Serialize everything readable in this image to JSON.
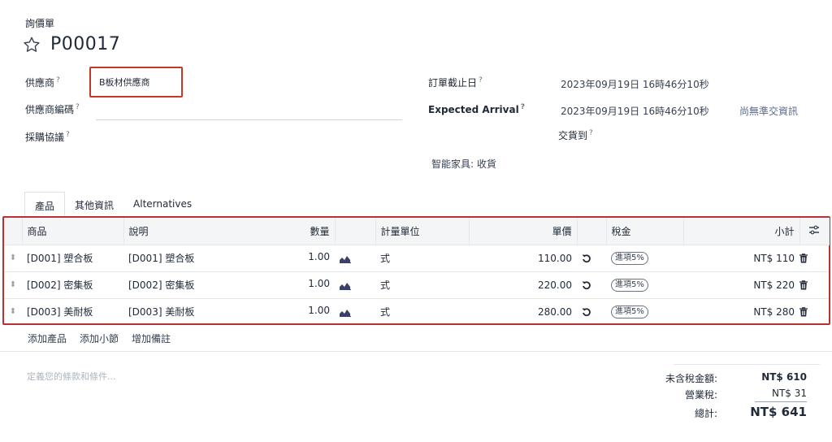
{
  "header": {
    "doc_type": "詢價單",
    "title": "P00017"
  },
  "form": {
    "vendor_label": "供應商",
    "vendor_value": "B板材供應商",
    "vendor_ref_label": "供應商編碼",
    "agreement_label": "採購協議",
    "order_deadline_label": "訂單截止日",
    "order_deadline_value": "2023年09月19日 16時46分10秒",
    "expected_arrival_label": "Expected Arrival",
    "expected_arrival_value": "2023年09月19日 16時46分10秒",
    "no_ontime_info": "尚無準交資訊",
    "deliver_to_label": "交貨到",
    "deliver_to_value": "智能家具: 收貨",
    "help_mark": "?"
  },
  "tabs": [
    {
      "label": "產品"
    },
    {
      "label": "其他資訊"
    },
    {
      "label": "Alternatives"
    }
  ],
  "table": {
    "columns": {
      "product": "商品",
      "description": "說明",
      "quantity": "數量",
      "uom": "計量單位",
      "unit_price": "單價",
      "taxes": "稅金",
      "subtotal": "小計"
    },
    "rows": [
      {
        "product": "[D001] 塑合板",
        "description": "[D001] 塑合板",
        "quantity": "1.00",
        "uom": "式",
        "unit_price": "110.00",
        "tax": "進項5%",
        "subtotal": "NT$ 110"
      },
      {
        "product": "[D002] 密集板",
        "description": "[D002] 密集板",
        "quantity": "1.00",
        "uom": "式",
        "unit_price": "220.00",
        "tax": "進項5%",
        "subtotal": "NT$ 220"
      },
      {
        "product": "[D003] 美耐板",
        "description": "[D003] 美耐板",
        "quantity": "1.00",
        "uom": "式",
        "unit_price": "280.00",
        "tax": "進項5%",
        "subtotal": "NT$ 280"
      }
    ]
  },
  "actions": {
    "add_product": "添加產品",
    "add_section": "添加小節",
    "add_note": "增加備註"
  },
  "terms_placeholder": "定義您的條款和條件...",
  "totals": {
    "untaxed_label": "未含稅金額:",
    "untaxed_value": "NT$ 610",
    "tax_label": "營業稅:",
    "tax_value": "NT$ 31",
    "total_label": "總計:",
    "total_value": "NT$ 641"
  },
  "colors": {
    "highlight_border": "#c0392b",
    "chart_icon": "#3b3f6b"
  }
}
